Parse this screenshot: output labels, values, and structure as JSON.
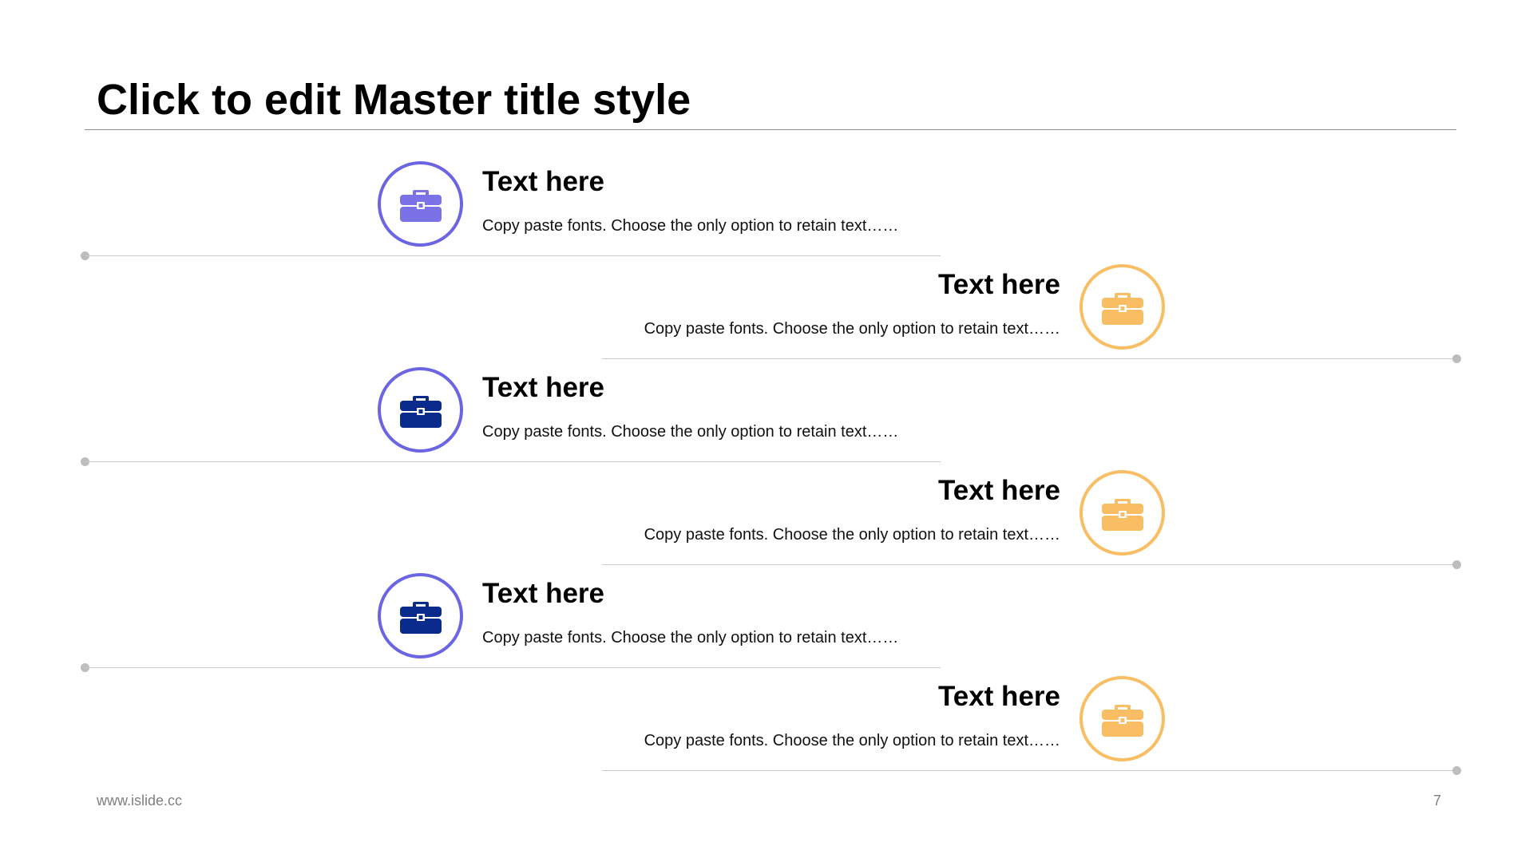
{
  "slide": {
    "title": "Click to edit Master title style",
    "footer_url": "www.islide.cc",
    "page_number": "7"
  },
  "colors": {
    "ring_purple": "#6b65e3",
    "ring_orange": "#f9be63",
    "icon_light_purple": "#7a72e6",
    "icon_navy": "#0b2b8c",
    "icon_orange": "#f9be63",
    "rule": "#c9c9c9"
  },
  "items": [
    {
      "heading": "Text here",
      "text": "Copy paste fonts. Choose the only option to retain text……",
      "icon": "briefcase-icon"
    },
    {
      "heading": "Text here",
      "text": "Copy paste fonts. Choose the only option to retain text……",
      "icon": "briefcase-icon"
    },
    {
      "heading": "Text here",
      "text": "Copy paste fonts. Choose the only option to retain text……",
      "icon": "briefcase-icon"
    },
    {
      "heading": "Text here",
      "text": "Copy paste fonts. Choose the only option to retain text……",
      "icon": "briefcase-icon"
    },
    {
      "heading": "Text here",
      "text": "Copy paste fonts. Choose the only option to retain text……",
      "icon": "briefcase-icon"
    },
    {
      "heading": "Text here",
      "text": "Copy paste fonts. Choose the only option to retain text……",
      "icon": "briefcase-icon"
    }
  ]
}
